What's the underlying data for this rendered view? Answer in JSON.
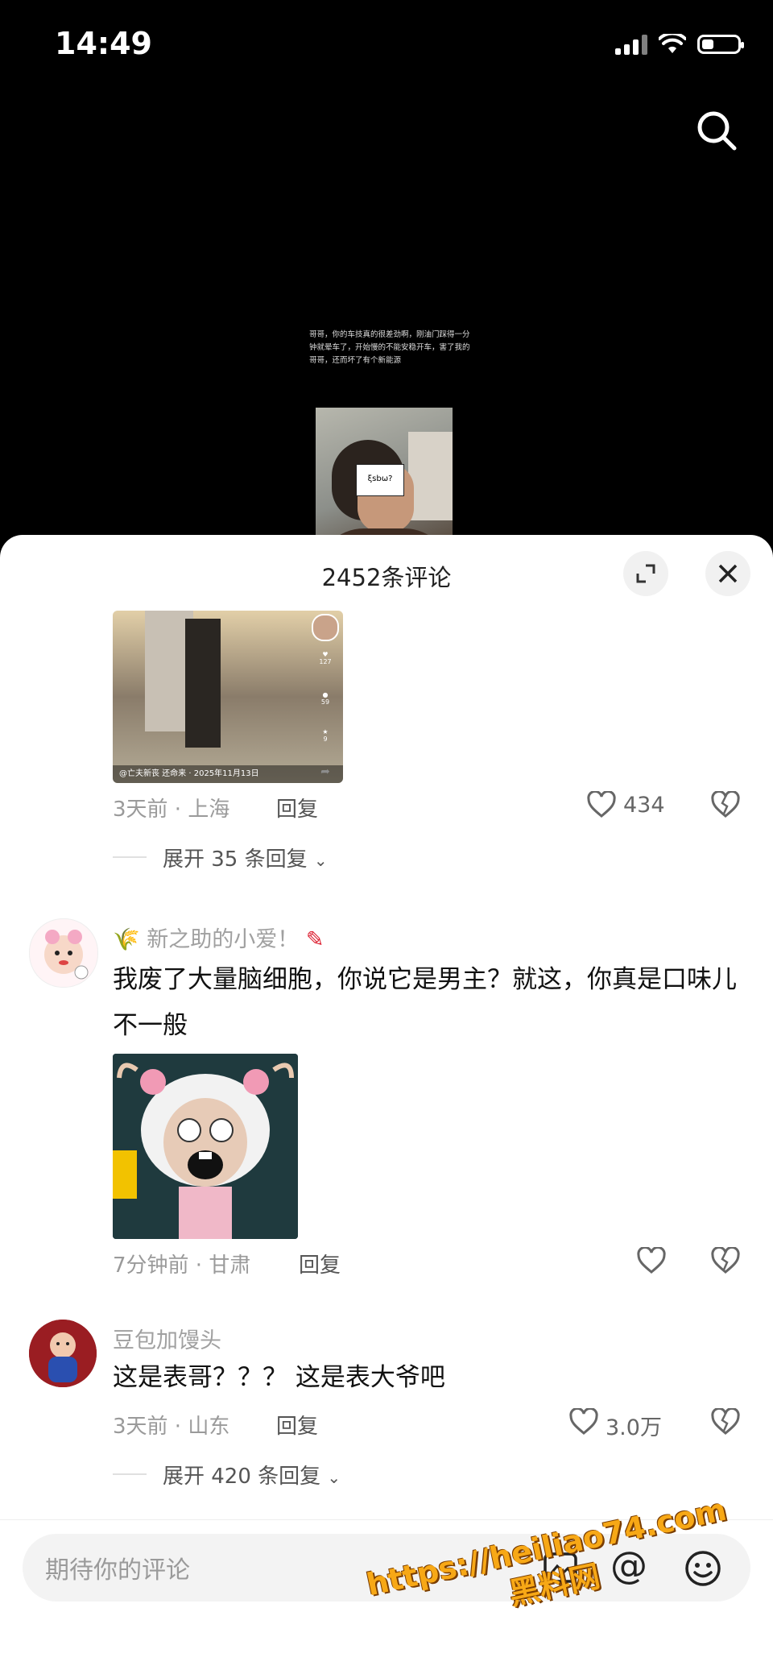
{
  "status_bar": {
    "time": "14:49"
  },
  "video": {
    "caption": "哥哥，你的车技真的很差劲啊，刚油门踩得一分钟就晕车了，开始慢的不能安稳开车，害了我的哥哥，还而坏了有个新能源",
    "mask_text": "ξsbω?"
  },
  "sheet": {
    "title": "2452条评论"
  },
  "comments": [
    {
      "thumbnail": {
        "likes": "127",
        "comments": "59",
        "stars": "9",
        "footer": "@亡夫新丧 还命来 · 2025年11月13日"
      },
      "meta": "3天前 · 上海",
      "reply_label": "回复",
      "likes": "434",
      "expand_label": "展开 35 条回复"
    },
    {
      "username": "新之助的小爱！",
      "text": "我废了大量脑细胞，你说它是男主？就这，你真是口味儿不一般",
      "meta": "7分钟前 · 甘肃",
      "reply_label": "回复",
      "likes": ""
    },
    {
      "username": "豆包加馒头",
      "text": "这是表哥？？？ 这是表大爷吧",
      "meta": "3天前 · 山东",
      "reply_label": "回复",
      "likes": "3.0万",
      "expand_label": "展开 420 条回复"
    }
  ],
  "input": {
    "placeholder": "期待你的评论",
    "at": "@"
  },
  "watermark": {
    "line1": "https://heiliao74.com",
    "line2": "黑料网"
  }
}
